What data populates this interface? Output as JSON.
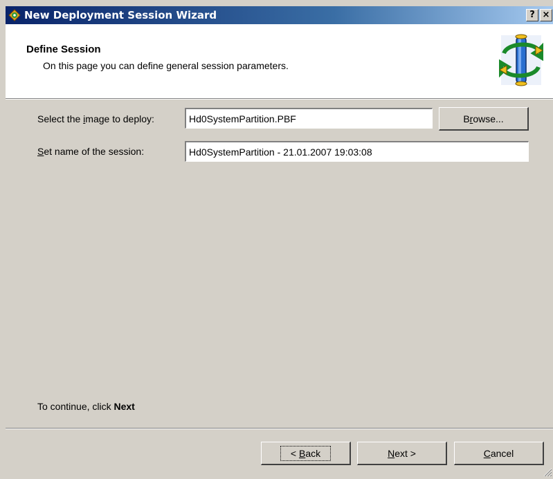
{
  "window": {
    "title": "New Deployment Session Wizard",
    "help_label": "?",
    "close_label": "×"
  },
  "header": {
    "title": "Define Session",
    "subtitle": "On this page you can define general session parameters."
  },
  "form": {
    "image_label_pre": "Select the ",
    "image_label_key": "i",
    "image_label_post": "mage to deploy:",
    "image_value": "Hd0SystemPartition.PBF",
    "browse_pre": "B",
    "browse_key": "r",
    "browse_post": "owse...",
    "session_label_key": "S",
    "session_label_post": "et name of the session:",
    "session_value": "Hd0SystemPartition - 21.01.2007 19:03:08"
  },
  "footer": {
    "continue_text": "To continue, click ",
    "continue_bold": "Next",
    "back_pre": "< ",
    "back_key": "B",
    "back_post": "ack",
    "next_key": "N",
    "next_post": "ext >",
    "cancel_key": "C",
    "cancel_post": "ancel"
  },
  "colors": {
    "titlebar_start": "#0a246a",
    "titlebar_end": "#a6caf0",
    "dialog_bg": "#d4d0c8"
  }
}
